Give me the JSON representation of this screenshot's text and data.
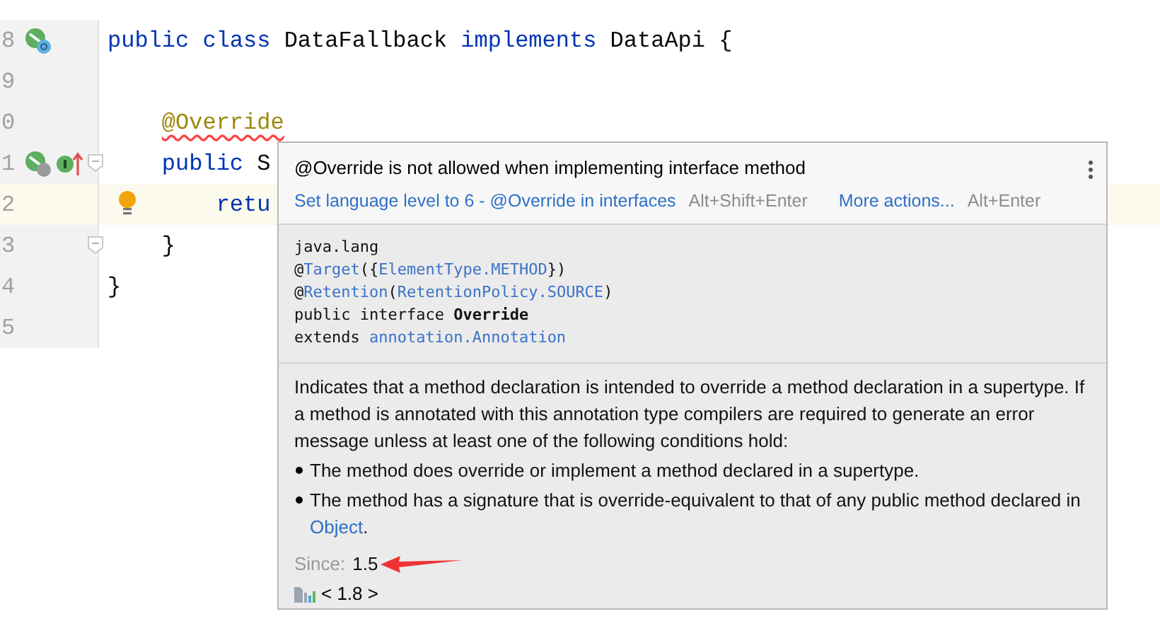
{
  "editor": {
    "lines": [
      {
        "number": "8",
        "markers": [
          {
            "kind": "class"
          }
        ],
        "tokens": [
          {
            "kind": "keyword",
            "text": "public class "
          },
          {
            "kind": "plain",
            "text": "DataFallback "
          },
          {
            "kind": "keyword",
            "text": "implements "
          },
          {
            "kind": "plain",
            "text": "DataApi {"
          }
        ]
      },
      {
        "number": "9"
      },
      {
        "number": "0",
        "tokens": [
          {
            "kind": "annotation",
            "text": "    @Override",
            "error": true
          }
        ]
      },
      {
        "number": "1",
        "markers": [
          {
            "kind": "method"
          },
          {
            "kind": "implements"
          }
        ],
        "fold": true,
        "tokens": [
          {
            "kind": "keyword",
            "text": "    public "
          },
          {
            "kind": "plain",
            "text": "S"
          }
        ]
      },
      {
        "number": "2",
        "current": true,
        "bulb": true,
        "tokens": [
          {
            "kind": "keyword",
            "text": "        retu"
          }
        ]
      },
      {
        "number": "3",
        "fold": true,
        "tokens": [
          {
            "kind": "plain",
            "text": "    }"
          }
        ]
      },
      {
        "number": "4",
        "tokens": [
          {
            "kind": "plain",
            "text": "}"
          }
        ]
      },
      {
        "number": "5"
      }
    ]
  },
  "popup": {
    "title": "@Override is not allowed when implementing interface method",
    "actions": [
      {
        "label": "Set language level to 6 - @Override in interfaces",
        "shortcut": "Alt+Shift+Enter"
      },
      {
        "label": "More actions...",
        "shortcut": "Alt+Enter"
      }
    ],
    "signature": [
      [
        {
          "kind": "plain",
          "text": "java.lang"
        }
      ],
      [
        {
          "kind": "plain",
          "text": "@"
        },
        {
          "kind": "link",
          "text": "Target"
        },
        {
          "kind": "plain",
          "text": "({"
        },
        {
          "kind": "link",
          "text": "ElementType.METHOD"
        },
        {
          "kind": "plain",
          "text": "})"
        }
      ],
      [
        {
          "kind": "plain",
          "text": "@"
        },
        {
          "kind": "link",
          "text": "Retention"
        },
        {
          "kind": "plain",
          "text": "("
        },
        {
          "kind": "link",
          "text": "RetentionPolicy.SOURCE"
        },
        {
          "kind": "plain",
          "text": ")"
        }
      ],
      [
        {
          "kind": "plain",
          "text": "public interface "
        },
        {
          "kind": "bold",
          "text": "Override"
        }
      ],
      [
        {
          "kind": "plain",
          "text": "extends "
        },
        {
          "kind": "link",
          "text": "annotation.Annotation"
        }
      ]
    ],
    "description": "Indicates that a method declaration is intended to override a method declaration in a supertype. If a method is annotated with this annotation type compilers are required to generate an error message unless at least one of the following conditions hold:",
    "bullets": [
      {
        "text": "The method does override or implement a method declared in a supertype."
      },
      {
        "text": "The method has a signature that is override-equivalent to that of any public method declared in",
        "link": "Object",
        "after": "."
      }
    ],
    "since_label": "Since:",
    "since_value": "1.5",
    "version": "< 1.8 >"
  }
}
